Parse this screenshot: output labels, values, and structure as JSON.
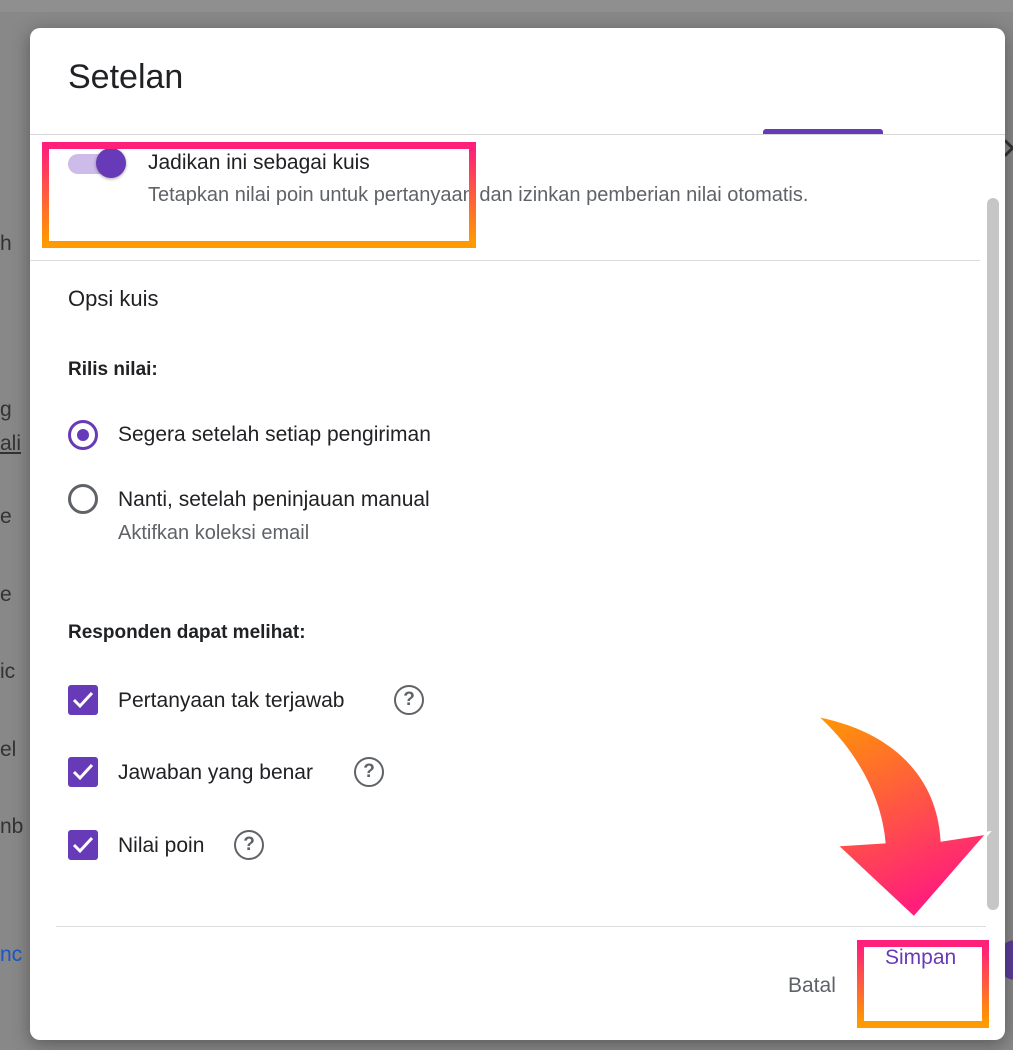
{
  "dialog": {
    "title": "Setelan"
  },
  "background": {
    "fragments": [
      "h",
      "g",
      "ali",
      "e",
      "e",
      "ic",
      "el",
      "nb",
      "nc"
    ]
  },
  "quiz_toggle": {
    "label": "Jadikan ini sebagai kuis",
    "description": "Tetapkan nilai poin untuk pertanyaan dan izinkan pemberian nilai otomatis.",
    "enabled": true
  },
  "quiz_options": {
    "section_title": "Opsi kuis",
    "release_grade": {
      "label": "Rilis nilai:",
      "options": [
        {
          "label": "Segera setelah setiap pengiriman",
          "selected": true
        },
        {
          "label": "Nanti, setelah peninjauan manual",
          "sublabel": "Aktifkan koleksi email",
          "selected": false
        }
      ]
    },
    "respondent_can_see": {
      "label": "Responden dapat melihat:",
      "items": [
        {
          "label": "Pertanyaan tak terjawab",
          "checked": true
        },
        {
          "label": "Jawaban yang benar",
          "checked": true
        },
        {
          "label": "Nilai poin",
          "checked": true
        }
      ]
    }
  },
  "footer": {
    "cancel_label": "Batal",
    "save_label": "Simpan"
  },
  "colors": {
    "accent": "#673ab7",
    "highlight_top": "#ff1f7a",
    "highlight_bottom": "#ff9a00"
  }
}
